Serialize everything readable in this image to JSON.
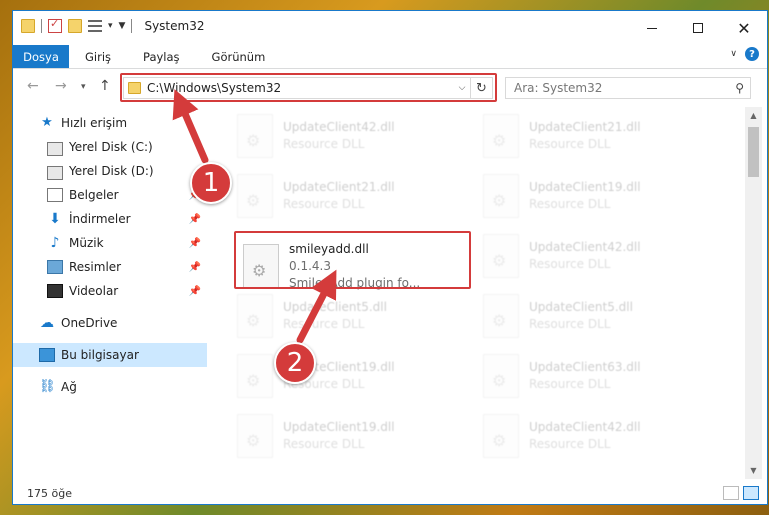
{
  "window": {
    "title": "System32"
  },
  "ribbon": {
    "tabs": [
      {
        "label": "Dosya"
      },
      {
        "label": "Giriş"
      },
      {
        "label": "Paylaş"
      },
      {
        "label": "Görünüm"
      }
    ]
  },
  "address": {
    "path": "C:\\Windows\\System32"
  },
  "search": {
    "placeholder": "Ara: System32"
  },
  "sidebar": {
    "items": [
      {
        "label": "Hızlı erişim",
        "icon": "star-icon"
      },
      {
        "label": "Yerel Disk (C:)",
        "icon": "drive-icon"
      },
      {
        "label": "Yerel Disk (D:)",
        "icon": "drive-icon"
      },
      {
        "label": "Belgeler",
        "icon": "documents-icon",
        "pinned": true
      },
      {
        "label": "İndirmeler",
        "icon": "download-icon",
        "pinned": true
      },
      {
        "label": "Müzik",
        "icon": "music-icon",
        "pinned": true
      },
      {
        "label": "Resimler",
        "icon": "pictures-icon",
        "pinned": true
      },
      {
        "label": "Videolar",
        "icon": "videos-icon",
        "pinned": true
      },
      {
        "label": "OneDrive",
        "icon": "cloud-icon"
      },
      {
        "label": "Bu bilgisayar",
        "icon": "computer-icon",
        "selected": true
      },
      {
        "label": "Ağ",
        "icon": "network-icon"
      }
    ]
  },
  "files": [
    {
      "name": "UpdateClient42.dll",
      "sub": "Resource DLL",
      "dim": true
    },
    {
      "name": "UpdateClient21.dll",
      "sub": "Resource DLL",
      "dim": true
    },
    {
      "name": "UpdateClient21.dll",
      "sub": "Resource DLL",
      "dim": true
    },
    {
      "name": "UpdateClient19.dll",
      "sub": "Resource DLL",
      "dim": true
    },
    {
      "name": "smileyadd.dll",
      "version": "0.1.4.3",
      "sub": "SmileyAdd plugin fo...",
      "dim": false
    },
    {
      "name": "UpdateClient42.dll",
      "sub": "Resource DLL",
      "dim": true
    },
    {
      "name": "UpdateClient5.dll",
      "sub": "Resource DLL",
      "dim": true
    },
    {
      "name": "UpdateClient5.dll",
      "sub": "Resource DLL",
      "dim": true
    },
    {
      "name": "UpdateClient19.dll",
      "sub": "Resource DLL",
      "dim": true
    },
    {
      "name": "UpdateClient63.dll",
      "sub": "Resource DLL",
      "dim": true
    },
    {
      "name": "UpdateClient19.dll",
      "sub": "Resource DLL",
      "dim": true
    },
    {
      "name": "UpdateClient42.dll",
      "sub": "Resource DLL",
      "dim": true
    }
  ],
  "status": {
    "count": "175 öğe"
  },
  "annotations": {
    "step1": "1",
    "step2": "2"
  },
  "colors": {
    "accent": "#1979ca",
    "highlight": "#d43b3b",
    "selected": "#cce8ff"
  }
}
